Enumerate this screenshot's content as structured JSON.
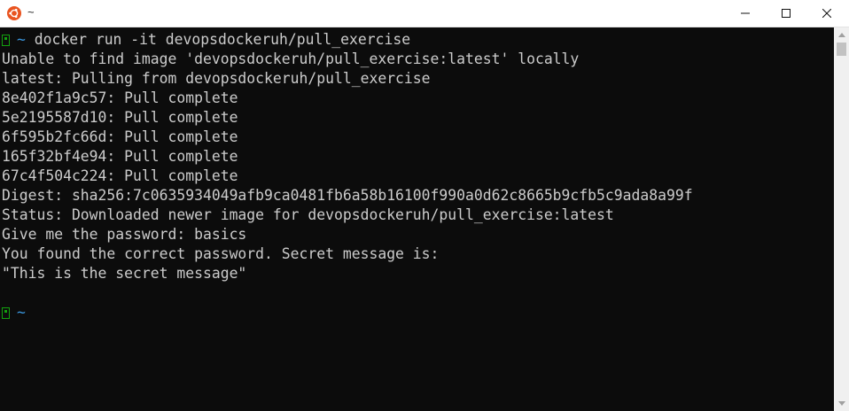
{
  "window": {
    "title": "~"
  },
  "terminal": {
    "prompt_symbol": "~",
    "command": "docker run -it devopsdockeruh/pull_exercise",
    "output": [
      "Unable to find image 'devopsdockeruh/pull_exercise:latest' locally",
      "latest: Pulling from devopsdockeruh/pull_exercise",
      "8e402f1a9c57: Pull complete",
      "5e2195587d10: Pull complete",
      "6f595b2fc66d: Pull complete",
      "165f32bf4e94: Pull complete",
      "67c4f504c224: Pull complete",
      "Digest: sha256:7c0635934049afb9ca0481fb6a58b16100f990a0d62c8665b9cfb5c9ada8a99f",
      "Status: Downloaded newer image for devopsdockeruh/pull_exercise:latest",
      "Give me the password: basics",
      "You found the correct password. Secret message is:",
      "\"This is the secret message\""
    ],
    "final_prompt_symbol": "~"
  },
  "colors": {
    "background": "#0c0c0c",
    "foreground": "#cccccc",
    "tilde": "#3a96dd",
    "prompt_icon": "#13a10e",
    "ubuntu_orange": "#e95420"
  },
  "icons": {
    "app": "ubuntu-logo-icon",
    "minimize": "minimize-icon",
    "maximize": "maximize-icon",
    "close": "close-icon",
    "prompt": "prompt-status-icon",
    "scroll_up": "chevron-up-icon",
    "scroll_down": "chevron-down-icon"
  }
}
